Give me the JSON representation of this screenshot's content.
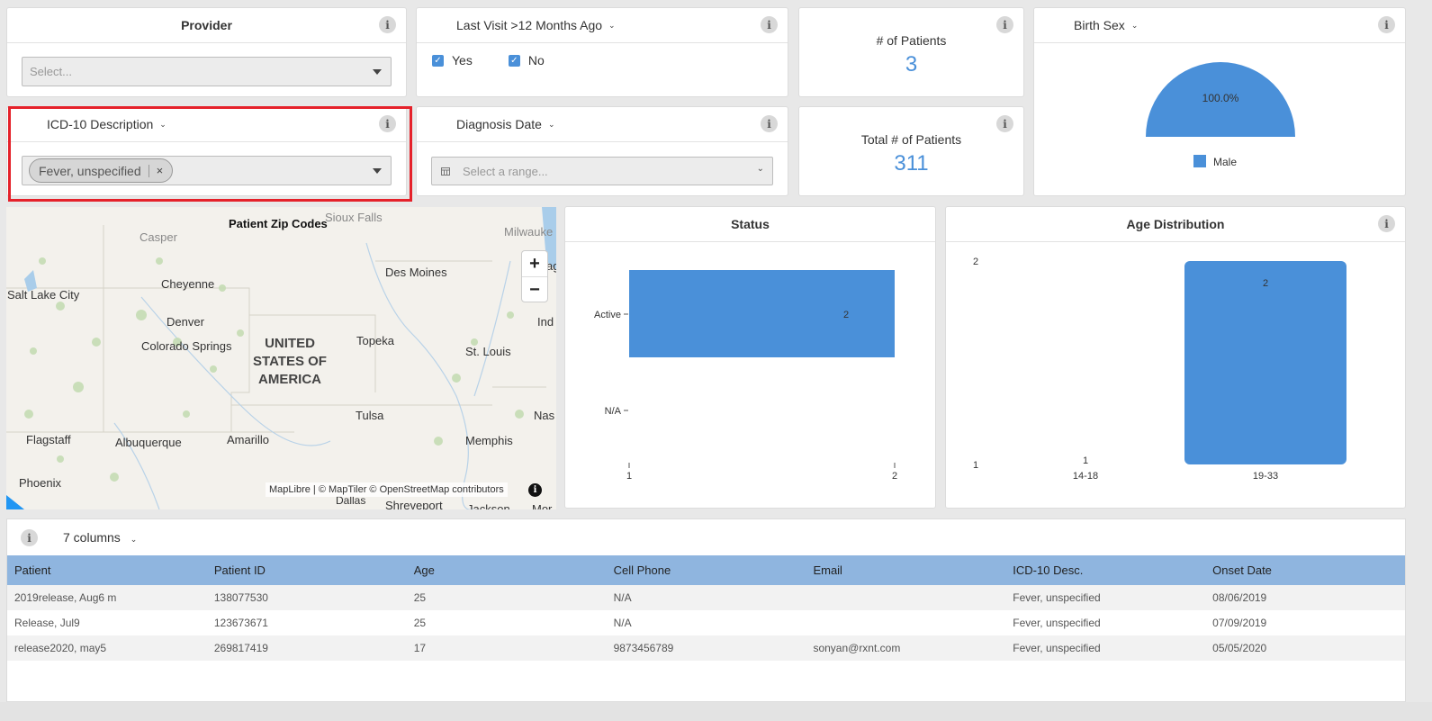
{
  "filters": {
    "provider": {
      "title": "Provider",
      "placeholder": "Select..."
    },
    "last_visit": {
      "title": "Last Visit >12 Months Ago",
      "options": [
        {
          "label": "Yes",
          "checked": true
        },
        {
          "label": "No",
          "checked": true
        }
      ]
    },
    "icd10": {
      "title": "ICD-10 Description",
      "chip": "Fever, unspecified"
    },
    "diagnosis_date": {
      "title": "Diagnosis Date",
      "placeholder": "Select a range..."
    }
  },
  "stats": {
    "patients": {
      "label": "# of Patients",
      "value": "3"
    },
    "total_patients": {
      "label": "Total # of Patients",
      "value": "311"
    }
  },
  "birth_sex": {
    "title": "Birth Sex",
    "slice_label": "100.0%",
    "legend": "Male",
    "color": "#4a90d9"
  },
  "map": {
    "title": "Patient Zip Codes",
    "labels": [
      "Sioux Falls",
      "Milwauke",
      "Casper",
      "Cheyenne",
      "Des Moines",
      "Salt Lake City",
      "Denver",
      "Colorado Springs",
      "Topeka",
      "Ind",
      "St. Louis",
      "Tulsa",
      "Nas",
      "Flagstaff",
      "Albuquerque",
      "Amarillo",
      "Memphis",
      "Phoenix",
      "Dallas",
      "Shreveport",
      "Jackson",
      "Mor",
      "ag"
    ],
    "country": [
      "UNITED",
      "STATES OF",
      "AMERICA"
    ],
    "zoom_in": "+",
    "zoom_out": "−",
    "attribution": "MapLibre | © MapTiler © OpenStreetMap contributors"
  },
  "chart_data": [
    {
      "type": "bar",
      "orientation": "horizontal",
      "title": "Status",
      "categories": [
        "Active",
        "N/A"
      ],
      "values": [
        2,
        0
      ],
      "data_labels": [
        "2",
        ""
      ],
      "x_ticks": [
        "1",
        "2"
      ],
      "xlim": [
        1,
        2
      ],
      "color": "#4a90d9"
    },
    {
      "type": "bar",
      "title": "Age Distribution",
      "categories": [
        "14-18",
        "19-33"
      ],
      "values": [
        1,
        2
      ],
      "data_labels": [
        "1",
        "2"
      ],
      "y_ticks": [
        "1",
        "2"
      ],
      "ylim": [
        1,
        2
      ],
      "color": "#4a90d9"
    }
  ],
  "table": {
    "columns_label": "7 columns",
    "headers": [
      "Patient",
      "Patient ID",
      "Age",
      "Cell Phone",
      "Email",
      "ICD-10 Desc.",
      "Onset Date"
    ],
    "rows": [
      [
        "2019release, Aug6 m",
        "138077530",
        "25",
        "N/A",
        "",
        "Fever, unspecified",
        "08/06/2019"
      ],
      [
        "Release, Jul9",
        "123673671",
        "25",
        "N/A",
        "",
        "Fever, unspecified",
        "07/09/2019"
      ],
      [
        "release2020, may5",
        "269817419",
        "17",
        "9873456789",
        "sonyan@rxnt.com",
        "Fever, unspecified",
        "05/05/2020"
      ]
    ]
  },
  "icons": {
    "info": "i",
    "chevron": "⌄",
    "remove": "×",
    "calendar": "calendar-icon",
    "check": "✓"
  }
}
